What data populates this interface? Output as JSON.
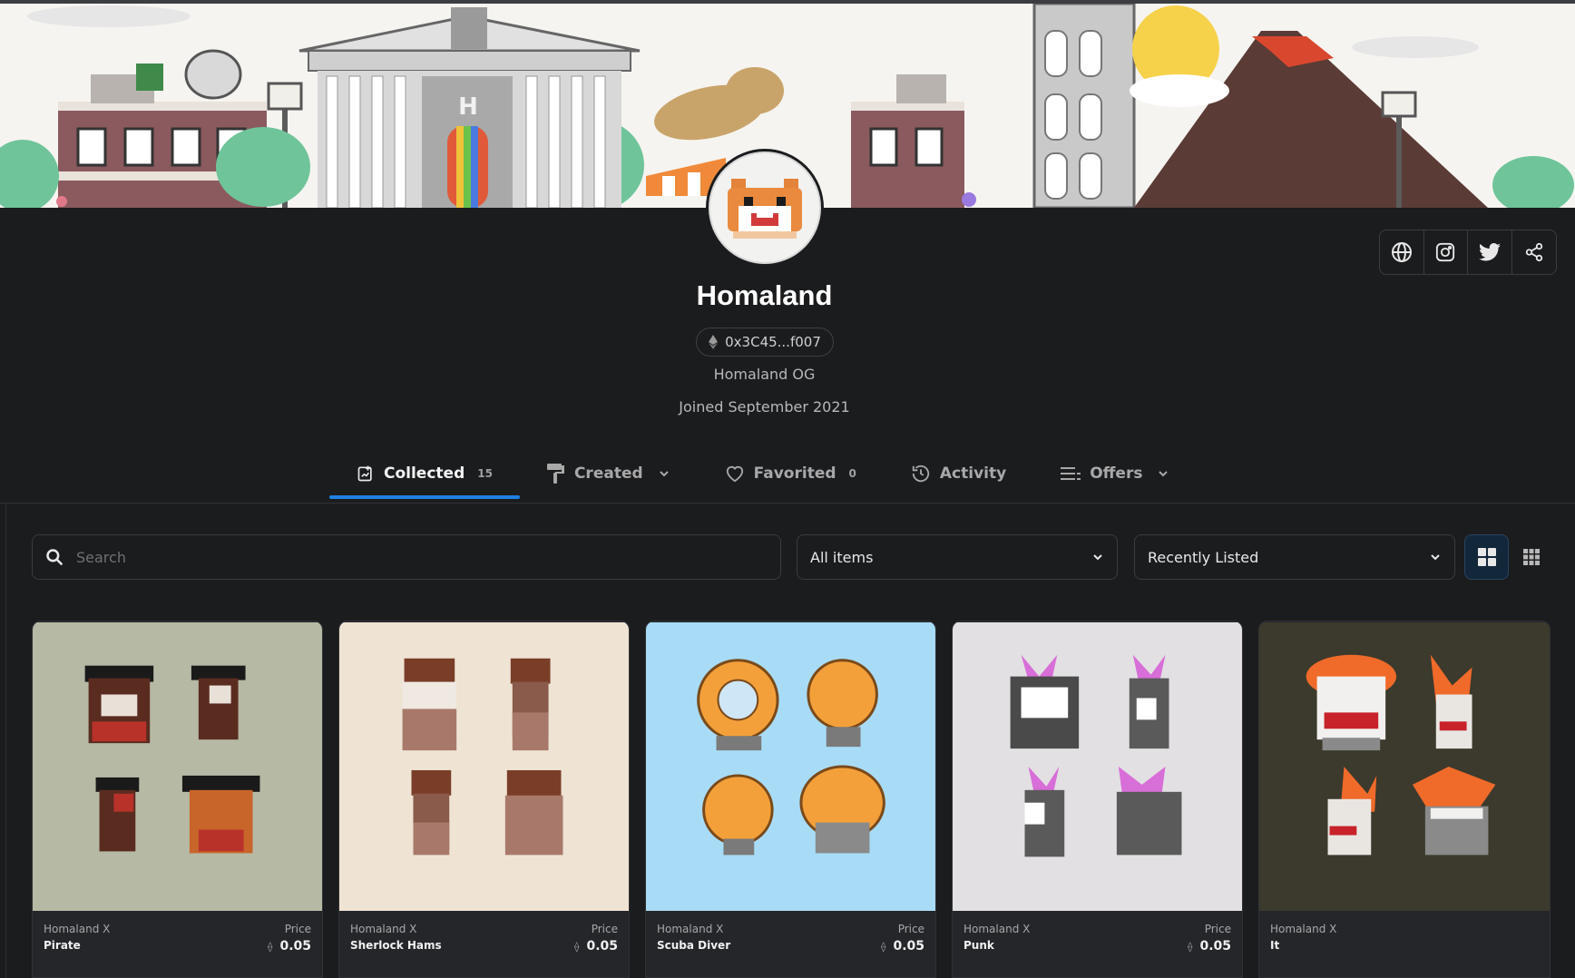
{
  "profile": {
    "name": "Homaland",
    "address": "0x3C45...f007",
    "bio": "Homaland OG",
    "joined": "Joined September 2021"
  },
  "social": {
    "icons": [
      "globe-icon",
      "instagram-icon",
      "twitter-icon",
      "share-icon"
    ]
  },
  "tabs": [
    {
      "label": "Collected",
      "count": "15",
      "icon": "collected-icon"
    },
    {
      "label": "Created",
      "icon": "paint-roller-icon"
    },
    {
      "label": "Favorited",
      "count": "0",
      "icon": "heart-icon"
    },
    {
      "label": "Activity",
      "icon": "history-icon"
    },
    {
      "label": "Offers",
      "icon": "list-icon"
    }
  ],
  "toolbar": {
    "search_placeholder": "Search",
    "filter_value": "All items",
    "sort_value": "Recently Listed"
  },
  "cards": [
    {
      "collection": "Homaland X",
      "name": "Pirate",
      "price_label": "Price",
      "price": "0.05",
      "bg": "#b6b9a4"
    },
    {
      "collection": "Homaland X",
      "name": "Sherlock Hams",
      "price_label": "Price",
      "price": "0.05",
      "bg": "#efe3d4"
    },
    {
      "collection": "Homaland X",
      "name": "Scuba Diver",
      "price_label": "Price",
      "price": "0.05",
      "bg": "#a8dcf6"
    },
    {
      "collection": "Homaland X",
      "name": "Punk",
      "price_label": "Price",
      "price": "0.05",
      "bg": "#e2e0e3"
    },
    {
      "collection": "Homaland X",
      "name": "It",
      "bg": "#3b3a2c"
    }
  ],
  "colors": {
    "accent": "#2081e2",
    "background": "#1b1c1e"
  }
}
